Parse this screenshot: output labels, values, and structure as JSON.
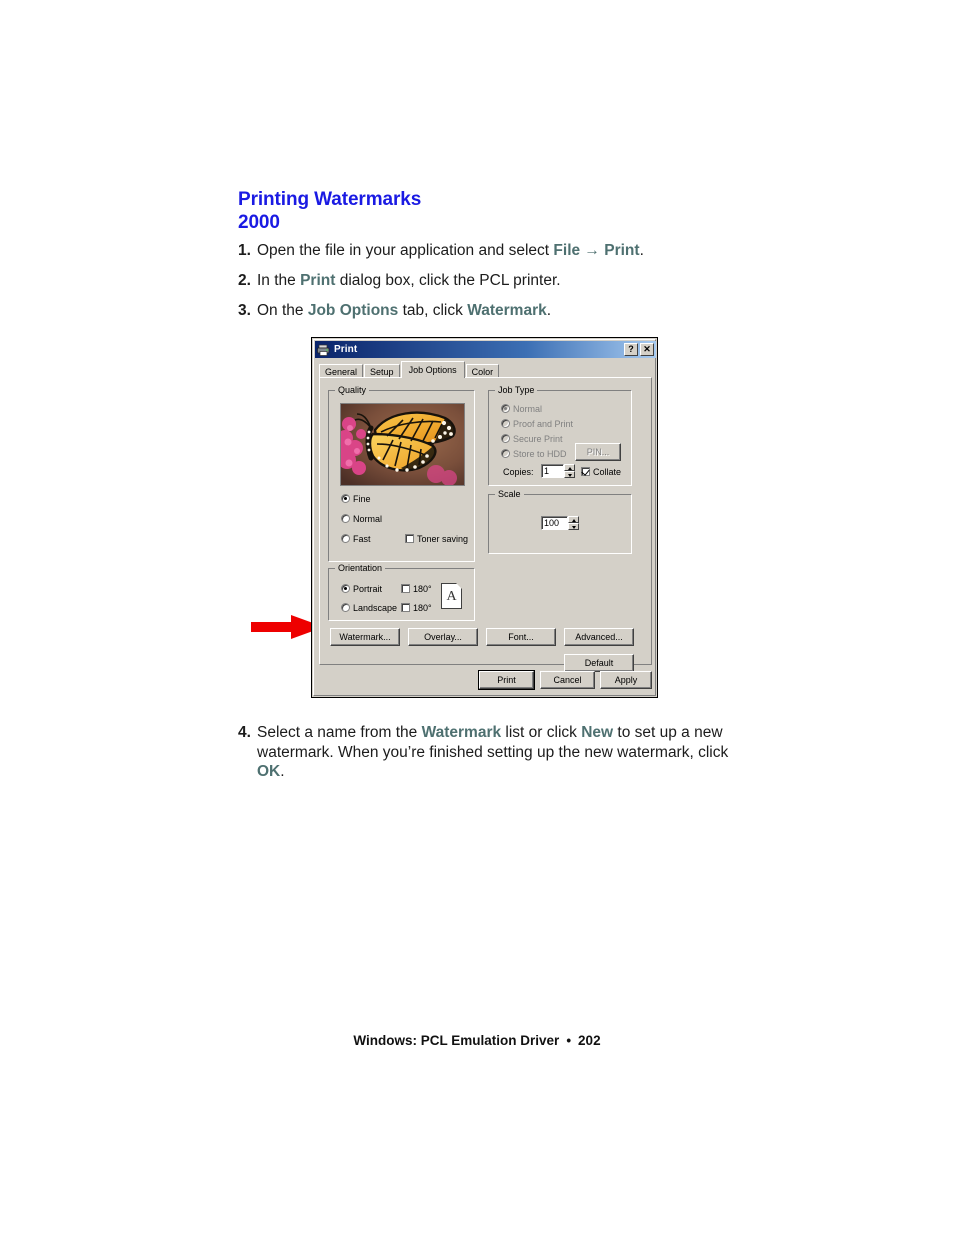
{
  "page": {
    "heading_line1": "Printing Watermarks",
    "heading_line2": "2000",
    "heading_color": "#1a1ae3",
    "emphasis_color": "#4e7070",
    "footer_text": "Windows: PCL Emulation Driver",
    "footer_separator": "•",
    "footer_page_number": "202"
  },
  "steps": [
    {
      "number": "1.",
      "parts": [
        {
          "t": "Open the file in your application and select ",
          "em": false
        },
        {
          "t": "File",
          "em": true
        },
        {
          "t": " → ",
          "em": true
        },
        {
          "t": "Print",
          "em": true
        },
        {
          "t": ".",
          "em": false
        }
      ]
    },
    {
      "number": "2.",
      "parts": [
        {
          "t": "In the ",
          "em": false
        },
        {
          "t": "Print",
          "em": true
        },
        {
          "t": " dialog box, click the PCL printer.",
          "em": false
        }
      ]
    },
    {
      "number": "3.",
      "parts": [
        {
          "t": "On the ",
          "em": false
        },
        {
          "t": "Job Options",
          "em": true
        },
        {
          "t": " tab, click ",
          "em": false
        },
        {
          "t": "Watermark",
          "em": true
        },
        {
          "t": ".",
          "em": false
        }
      ]
    }
  ],
  "step4": {
    "number": "4.",
    "parts": [
      {
        "t": "Select a name from the ",
        "em": false
      },
      {
        "t": "Watermark",
        "em": true
      },
      {
        "t": " list or click ",
        "em": false
      },
      {
        "t": "New",
        "em": true
      },
      {
        "t": " to set up a new watermark. When you’re finished setting up the new watermark, click ",
        "em": false
      },
      {
        "t": "OK",
        "em": true
      },
      {
        "t": ".",
        "em": false
      }
    ]
  },
  "annotation": {
    "arrow_color": "#ee0000",
    "arrow_points_to": "Watermark..."
  },
  "dialog": {
    "title": "Print",
    "title_icon": "printer-icon",
    "titlebar_color_start": "#0a246a",
    "titlebar_color_end": "#a6caf0",
    "help_button": "?",
    "close_button": "✕",
    "tabs": [
      {
        "label": "General",
        "active": false
      },
      {
        "label": "Setup",
        "active": false
      },
      {
        "label": "Job Options",
        "active": true
      },
      {
        "label": "Color",
        "active": false
      }
    ],
    "quality": {
      "group_label": "Quality",
      "preview_alt": "monarch-butterfly-preview",
      "options": [
        {
          "label": "Fine",
          "selected": true
        },
        {
          "label": "Normal",
          "selected": false
        },
        {
          "label": "Fast",
          "selected": false
        }
      ],
      "toner_saving": {
        "label": "Toner saving",
        "checked": false
      }
    },
    "orientation": {
      "group_label": "Orientation",
      "options": [
        {
          "label": "Portrait",
          "selected": true,
          "rotate_label": "180°",
          "rotate_checked": false
        },
        {
          "label": "Landscape",
          "selected": false,
          "rotate_label": "180°",
          "rotate_checked": false
        }
      ],
      "preview_letter": "A"
    },
    "job_type": {
      "group_label": "Job Type",
      "disabled": true,
      "options": [
        {
          "label": "Normal",
          "selected": true
        },
        {
          "label": "Proof and Print",
          "selected": false
        },
        {
          "label": "Secure Print",
          "selected": false
        },
        {
          "label": "Store to HDD",
          "selected": false
        }
      ],
      "pin_button": "PIN...",
      "copies_label": "Copies:",
      "copies_value": "1",
      "collate": {
        "label": "Collate",
        "checked": true
      }
    },
    "scale": {
      "group_label": "Scale",
      "value": "100"
    },
    "action_buttons": [
      {
        "label": "Watermark...",
        "name": "watermark-button"
      },
      {
        "label": "Overlay...",
        "name": "overlay-button"
      },
      {
        "label": "Font...",
        "name": "font-button"
      },
      {
        "label": "Advanced...",
        "name": "advanced-button"
      }
    ],
    "default_button": "Default",
    "footer_buttons": [
      {
        "label": "Print",
        "default": true
      },
      {
        "label": "Cancel",
        "default": false
      },
      {
        "label": "Apply",
        "default": false
      }
    ]
  }
}
